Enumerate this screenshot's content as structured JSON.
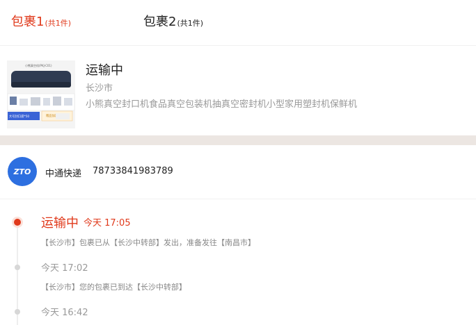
{
  "tabs": [
    {
      "label": "包裹1",
      "count": "(共1件)"
    },
    {
      "label": "包裹2",
      "count": "(共1件)"
    }
  ],
  "package": {
    "status": "运输中",
    "city": "长沙市",
    "product_name": "小熊真空封口机食品真空包装机抽真空密封机小型家用塑封机保鲜机",
    "image_caption": "小熊真空机(PKJ-C01)",
    "image_label_1": "大号封口袋*50",
    "image_label_2": "赠品加送"
  },
  "courier": {
    "logo_text": "ZTO",
    "name": "中通快递",
    "tracking_number": "78733841983789"
  },
  "events": [
    {
      "title": "运输中",
      "time": "今天 17:05",
      "desc": "【长沙市】包裹已从【长沙中转部】发出，准备发往【南昌市】"
    },
    {
      "time": "今天 17:02",
      "desc": "【长沙市】您的包裹已到达【长沙中转部】"
    },
    {
      "time": "今天 16:42"
    }
  ],
  "colors": {
    "accent": "#e0391b",
    "courier_blue": "#2d6fe0",
    "separator": "#ece6e2"
  }
}
